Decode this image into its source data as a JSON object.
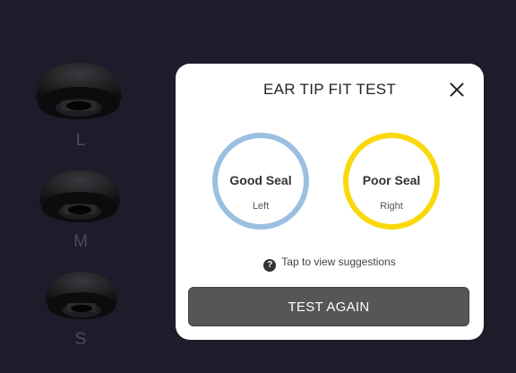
{
  "ear_tips": [
    {
      "size": "L"
    },
    {
      "size": "M"
    },
    {
      "size": "S"
    }
  ],
  "modal": {
    "title": "EAR TIP FIT TEST",
    "close_icon": "close-icon",
    "left": {
      "status": "Good Seal",
      "side": "Left",
      "color": "#9abfe0"
    },
    "right": {
      "status": "Poor Seal",
      "side": "Right",
      "color": "#fad80a"
    },
    "hint": "Tap to view suggestions",
    "help_icon": "question-icon",
    "help_glyph": "?",
    "button_label": "TEST AGAIN"
  },
  "colors": {
    "background": "#1c1c2a",
    "button": "#565656"
  }
}
